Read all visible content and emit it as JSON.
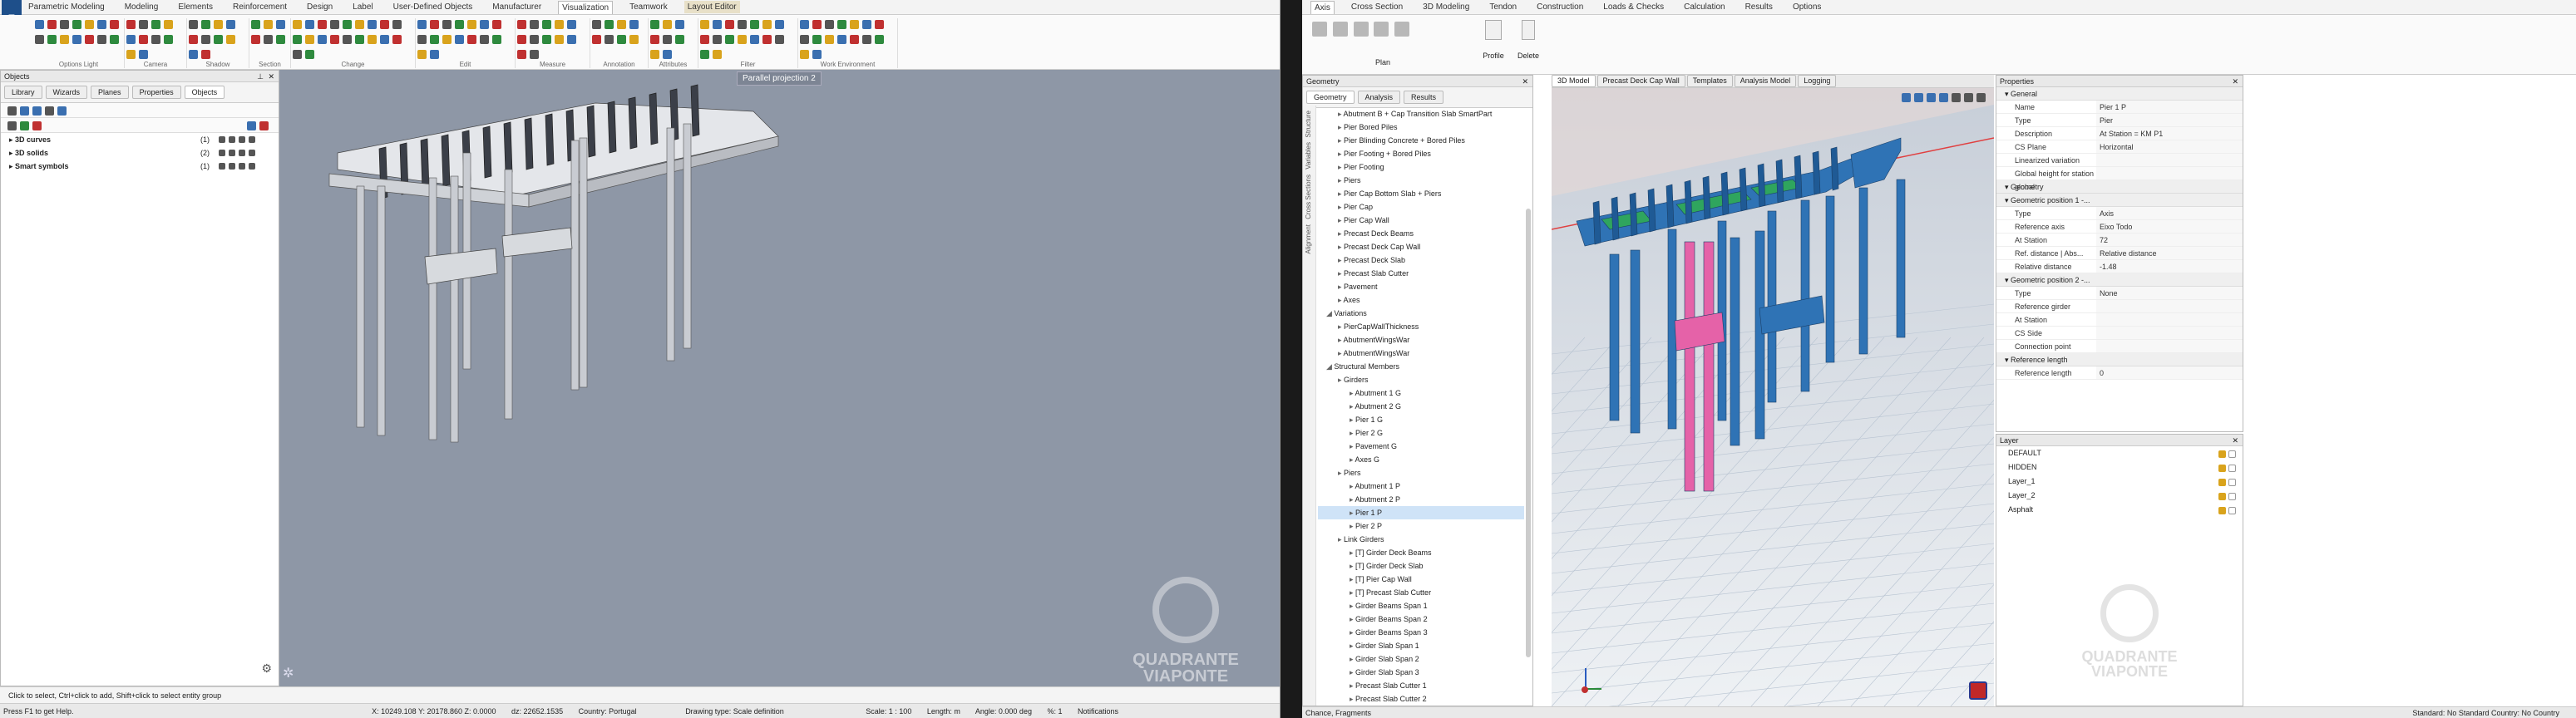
{
  "left_app": {
    "menu_tabs": [
      "Parametric Modeling",
      "Modeling",
      "Elements",
      "Reinforcement",
      "Design",
      "Label",
      "User-Defined Objects",
      "Manufacturer",
      "Visualization",
      "Teamwork",
      "Layout Editor"
    ],
    "ribbon_groups": [
      "Options Light",
      "Camera",
      "Shadow",
      "Section",
      "Change",
      "Edit",
      "Measure",
      "Annotation",
      "Attributes",
      "Filter",
      "Work Environment"
    ],
    "tooltip": "Parallel projection 2",
    "objects_panel": {
      "title": "Objects",
      "tabs": [
        "Library",
        "Wizards",
        "Planes",
        "Properties",
        "Objects"
      ],
      "items": [
        {
          "label": "3D curves",
          "count": "(1)"
        },
        {
          "label": "3D solids",
          "count": "(2)"
        },
        {
          "label": "Smart symbols",
          "count": "(1)"
        }
      ]
    },
    "hint": "Click to select, Ctrl+click to add, Shift+click to select entity group",
    "statusbar": {
      "help": "Press F1 to get Help.",
      "coords": "X: 10249.108  Y: 20178.860  Z: 0.0000",
      "dz": "dz: 22652.1535",
      "country": "Country: Portugal",
      "drawing_type": "Drawing type: Scale definition",
      "scale": "Scale: 1 : 100",
      "length": "Length: m",
      "angle": "Angle: 0.000 deg",
      "percent": "%: 1",
      "notifications": "Notifications"
    },
    "watermark": {
      "line1": "QUADRANTE",
      "line2": "VIAPONTE"
    }
  },
  "right_app": {
    "menu_tabs": [
      "Axis",
      "Cross Section",
      "3D Modeling",
      "Tendon",
      "Construction",
      "Loads & Checks",
      "Calculation",
      "Results",
      "Options"
    ],
    "ribbon_buttons": {
      "plan": "Plan",
      "profile": "Profile",
      "delete": "Delete"
    },
    "geometry_panel": {
      "title": "Geometry",
      "tabs": [
        "Geometry",
        "Analysis",
        "Results"
      ],
      "side_labels": [
        "Structure",
        "Variables",
        "Cross Sections",
        "Alignment"
      ],
      "items": [
        {
          "label": "Abutment B + Cap Transition Slab SmartPart",
          "indent": 1
        },
        {
          "label": "Pier Bored Piles",
          "indent": 1
        },
        {
          "label": "Pier Blinding Concrete + Bored Piles",
          "indent": 1
        },
        {
          "label": "Pier Footing + Bored Piles",
          "indent": 1
        },
        {
          "label": "Pier Footing",
          "indent": 1
        },
        {
          "label": "Piers",
          "indent": 1
        },
        {
          "label": "Pier Cap Bottom Slab + Piers",
          "indent": 1
        },
        {
          "label": "Pier Cap",
          "indent": 1
        },
        {
          "label": "Pier Cap Wall",
          "indent": 1
        },
        {
          "label": "Precast Deck Beams",
          "indent": 1
        },
        {
          "label": "Precast Deck Cap Wall",
          "indent": 1
        },
        {
          "label": "Precast Deck Slab",
          "indent": 1
        },
        {
          "label": "Precast Slab Cutter",
          "indent": 1
        },
        {
          "label": "Pavement",
          "indent": 1
        },
        {
          "label": "Axes",
          "indent": 1
        },
        {
          "label": "Variations",
          "indent": 0
        },
        {
          "label": "PierCapWallThickness",
          "indent": 1
        },
        {
          "label": "AbutmentWingsWar",
          "indent": 1
        },
        {
          "label": "AbutmentWingsWar",
          "indent": 1
        },
        {
          "label": "Structural Members",
          "indent": 0
        },
        {
          "label": "Girders",
          "indent": 1
        },
        {
          "label": "Abutment 1 G",
          "indent": 2
        },
        {
          "label": "Abutment 2 G",
          "indent": 2
        },
        {
          "label": "Pier 1 G",
          "indent": 2
        },
        {
          "label": "Pier 2 G",
          "indent": 2
        },
        {
          "label": "Pavement G",
          "indent": 2
        },
        {
          "label": "Axes G",
          "indent": 2
        },
        {
          "label": "Piers",
          "indent": 1
        },
        {
          "label": "Abutment 1 P",
          "indent": 2
        },
        {
          "label": "Abutment 2 P",
          "indent": 2
        },
        {
          "label": "Pier 1 P",
          "indent": 2,
          "selected": true
        },
        {
          "label": "Pier 2 P",
          "indent": 2
        },
        {
          "label": "Link Girders",
          "indent": 1
        },
        {
          "label": "[T] Girder Deck Beams",
          "indent": 2
        },
        {
          "label": "[T] Girder Deck Slab",
          "indent": 2
        },
        {
          "label": "[T] Pier Cap Wall",
          "indent": 2
        },
        {
          "label": "[T] Precast Slab Cutter",
          "indent": 2
        },
        {
          "label": "Girder Beams Span 1",
          "indent": 2
        },
        {
          "label": "Girder Beams Span 2",
          "indent": 2
        },
        {
          "label": "Girder Beams Span 3",
          "indent": 2
        },
        {
          "label": "Girder Slab Span 1",
          "indent": 2
        },
        {
          "label": "Girder Slab Span 2",
          "indent": 2
        },
        {
          "label": "Girder Slab Span 3",
          "indent": 2
        },
        {
          "label": "Precast Slab Cutter 1",
          "indent": 2
        },
        {
          "label": "Precast Slab Cutter 2",
          "indent": 2
        }
      ]
    },
    "view_tabs": [
      "3D Model",
      "Precast Deck Cap Wall",
      "Templates",
      "Analysis Model",
      "Logging"
    ],
    "properties": {
      "title": "Properties",
      "general_label": "General",
      "rows_general": [
        {
          "k": "Name",
          "v": "Pier 1 P"
        },
        {
          "k": "Type",
          "v": "Pier"
        },
        {
          "k": "Description",
          "v": "At Station = KM P1"
        },
        {
          "k": "CS Plane",
          "v": "Horizontal"
        },
        {
          "k": "Linearized variation",
          "v": ""
        },
        {
          "k": "Global height for station global",
          "v": ""
        }
      ],
      "geometry_label": "Geometry",
      "geo1_label": "Geometric position 1 -...",
      "rows_geo1": [
        {
          "k": "Type",
          "v": "Axis"
        },
        {
          "k": "Reference axis",
          "v": "Eixo Todo"
        },
        {
          "k": "At Station",
          "v": "72"
        },
        {
          "k": "Ref. distance | Abs...",
          "v": "Relative distance"
        },
        {
          "k": "Relative distance",
          "v": "-1.48"
        }
      ],
      "geo2_label": "Geometric position 2 -...",
      "rows_geo2": [
        {
          "k": "Type",
          "v": "None"
        },
        {
          "k": "Reference girder",
          "v": ""
        },
        {
          "k": "At Station",
          "v": ""
        },
        {
          "k": "CS Side",
          "v": ""
        },
        {
          "k": "Connection point",
          "v": ""
        }
      ],
      "reflen_label": "Reference length",
      "rows_ref": [
        {
          "k": "Reference length",
          "v": "0"
        }
      ]
    },
    "layers": {
      "title": "Layer",
      "items": [
        "DEFAULT",
        "HIDDEN",
        "Layer_1",
        "Layer_2",
        "Asphalt"
      ]
    },
    "statusbar": {
      "left": "Chance, Fragments",
      "right": "Standard: No Standard  Country: No Country"
    },
    "watermark": {
      "line1": "QUADRANTE",
      "line2": "VIAPONTE"
    }
  },
  "colors": {
    "left_viewport": "#8e97a6",
    "model_blue": "#2f73b5",
    "pier_selected": "#e562a8",
    "deck_green": "#2fa55e"
  }
}
